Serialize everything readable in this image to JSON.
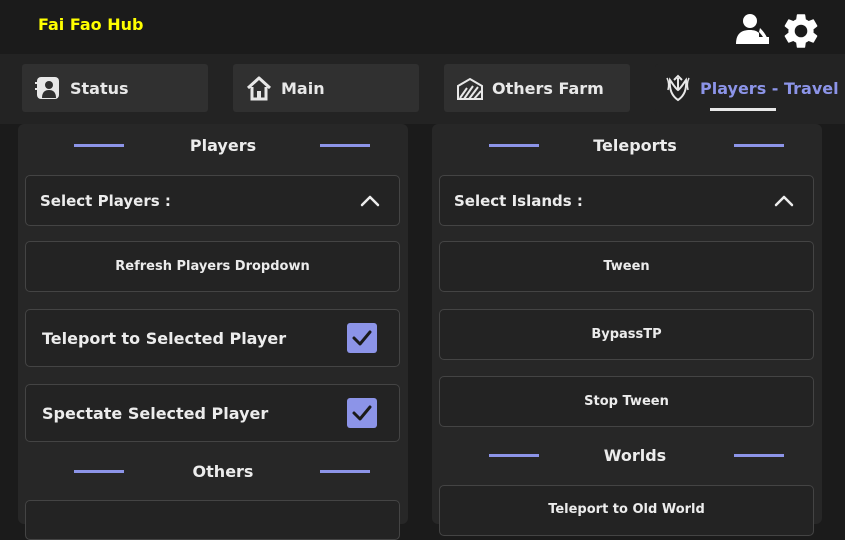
{
  "app": {
    "title": "Fai Fao Hub",
    "title_color": "#ffff00",
    "accent": "#8c94e8"
  },
  "header_icons": [
    "user-call-icon",
    "gear-icon"
  ],
  "tabs": [
    {
      "label": "Status",
      "icon": "status-icon"
    },
    {
      "label": "Main",
      "icon": "home-icon"
    },
    {
      "label": "Others Farm",
      "icon": "farm-icon"
    },
    {
      "label": "Players - Travel",
      "icon": "travel-icon",
      "active": true
    }
  ],
  "left_panel": {
    "section_title": "Players",
    "dropdown_label": "Select Players :",
    "refresh_button": "Refresh Players Dropdown",
    "toggles": [
      {
        "label": "Teleport to Selected Player",
        "checked": true
      },
      {
        "label": "Spectate Selected Player",
        "checked": true
      }
    ],
    "section_title_2": "Others"
  },
  "right_panel": {
    "section_title": "Teleports",
    "dropdown_label": "Select Islands :",
    "buttons": [
      "Tween",
      "BypassTP",
      "Stop Tween"
    ],
    "section_title_2": "Worlds",
    "worlds_buttons": [
      "Teleport to Old World"
    ]
  }
}
